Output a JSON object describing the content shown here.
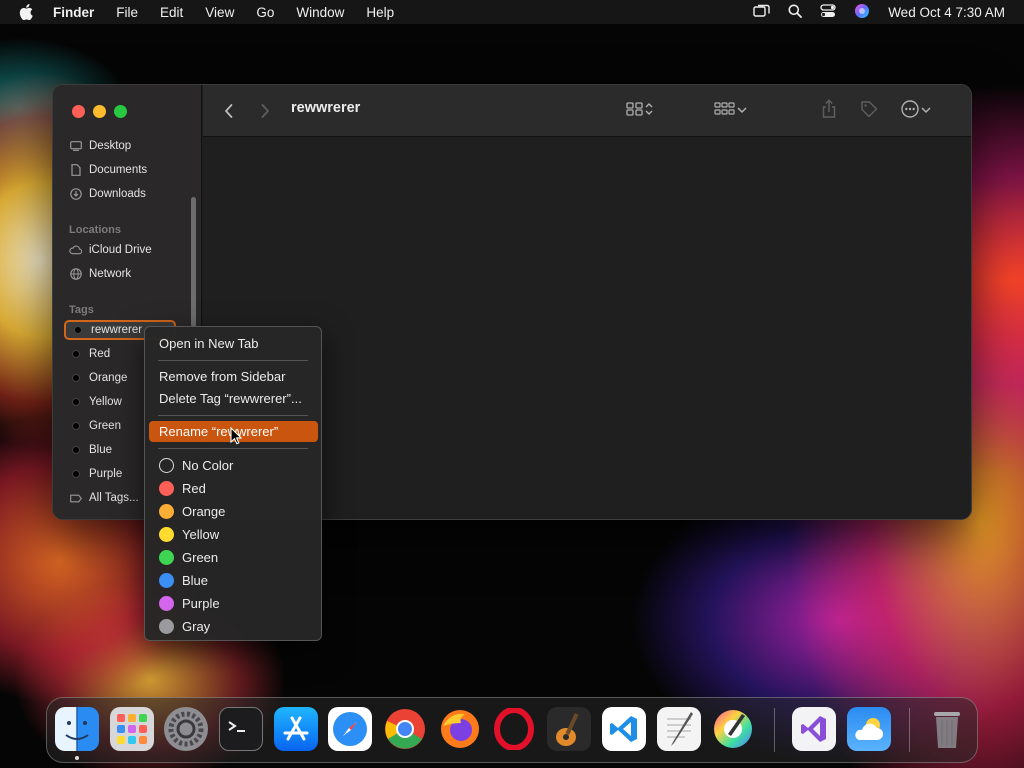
{
  "menubar": {
    "app_name": "Finder",
    "items": [
      "File",
      "Edit",
      "View",
      "Go",
      "Window",
      "Help"
    ],
    "clock": "Wed Oct 4  7:30 AM"
  },
  "finder": {
    "title": "rewwrerer",
    "sidebar": {
      "favorites": [
        {
          "label": "Desktop",
          "icon": "desktop-icon"
        },
        {
          "label": "Documents",
          "icon": "document-icon"
        },
        {
          "label": "Downloads",
          "icon": "download-icon"
        }
      ],
      "locations_header": "Locations",
      "locations": [
        {
          "label": "iCloud Drive",
          "icon": "cloud-icon"
        },
        {
          "label": "Network",
          "icon": "globe-icon"
        }
      ],
      "tags_header": "Tags",
      "tags": [
        {
          "label": "rewwrerer",
          "selected": true
        },
        {
          "label": "Red"
        },
        {
          "label": "Orange"
        },
        {
          "label": "Yellow"
        },
        {
          "label": "Green"
        },
        {
          "label": "Blue"
        },
        {
          "label": "Purple"
        }
      ],
      "all_tags": "All Tags..."
    }
  },
  "context_menu": {
    "open_new_tab": "Open in New Tab",
    "remove_sidebar": "Remove from Sidebar",
    "delete_tag": "Delete Tag “rewwrerer”...",
    "rename": "Rename “rewwrerer”",
    "colors": [
      {
        "label": "No Color",
        "color": ""
      },
      {
        "label": "Red",
        "color": "#fe5f57"
      },
      {
        "label": "Orange",
        "color": "#fdae34"
      },
      {
        "label": "Yellow",
        "color": "#fedb2e"
      },
      {
        "label": "Green",
        "color": "#3ed552"
      },
      {
        "label": "Blue",
        "color": "#3a8ff5"
      },
      {
        "label": "Purple",
        "color": "#d466ee"
      },
      {
        "label": "Gray",
        "color": "#9b9b9f"
      }
    ]
  },
  "dock": {
    "apps": [
      "Finder",
      "Launchpad",
      "System Settings",
      "Terminal",
      "App Store",
      "Safari",
      "Google Chrome",
      "Firefox",
      "Opera",
      "GarageBand",
      "Visual Studio Code",
      "TextEdit",
      "Pixelmator",
      "Visual Studio",
      "Weather",
      "Trash"
    ]
  },
  "colors": {
    "accent": "#c9550f",
    "close": "#fe5f57",
    "minimize": "#febc2e",
    "zoom": "#28c840"
  }
}
